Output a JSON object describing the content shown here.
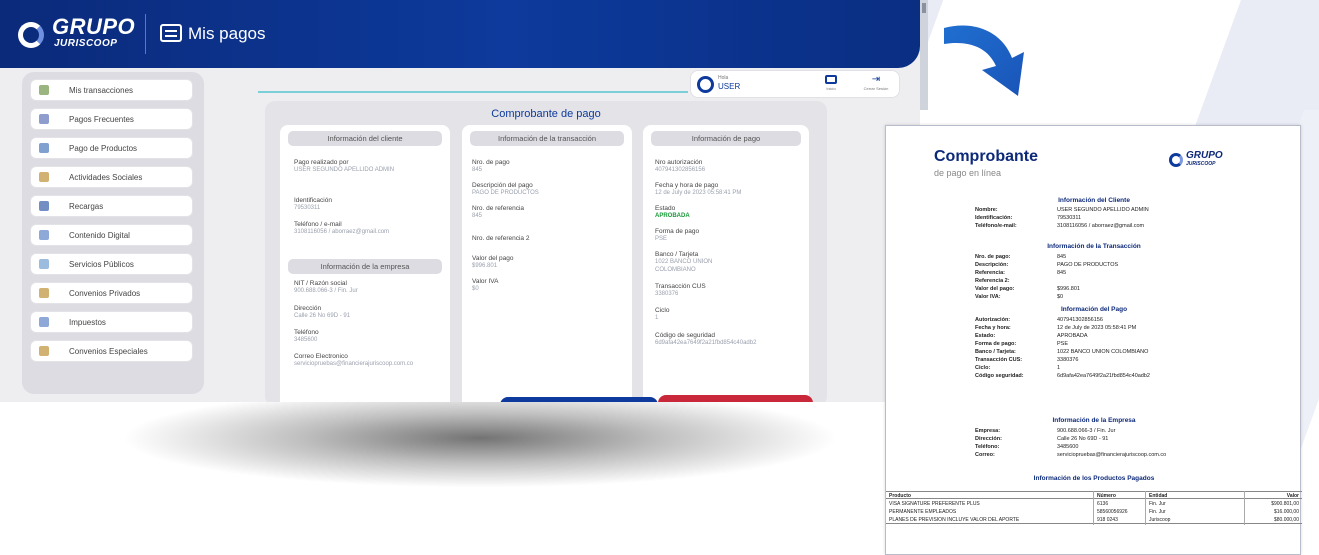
{
  "app": {
    "brand": "GRUPO",
    "brand_sub": "JURISCOOP",
    "title": "Mis pagos"
  },
  "sidebar": {
    "items": [
      {
        "label": "Mis transacciones",
        "color": "#8aa86a"
      },
      {
        "label": "Pagos Frecuentes",
        "color": "#7a8cc4"
      },
      {
        "label": "Pago de Productos",
        "color": "#6a8fc8"
      },
      {
        "label": "Actividades Sociales",
        "color": "#c9a45a"
      },
      {
        "label": "Recargas",
        "color": "#5a7ab8"
      },
      {
        "label": "Contenido Digital",
        "color": "#7a9ad0"
      },
      {
        "label": "Servicios Públicos",
        "color": "#8ab0d8"
      },
      {
        "label": "Convenios Privados",
        "color": "#c9a45a"
      },
      {
        "label": "Impuestos",
        "color": "#7a9ad0"
      },
      {
        "label": "Convenios Especiales",
        "color": "#c9a45a"
      }
    ]
  },
  "user": {
    "greeting": "Hola",
    "name": "USER",
    "btn_inicio": "Inicio",
    "btn_salir": "Cerrar Sesión"
  },
  "receipt": {
    "title": "Comprobante de pago",
    "client": {
      "header": "Información del cliente",
      "fields": [
        {
          "label": "Pago realizado por",
          "value": "USER SEGUNDO APELLIDO ADMIN"
        },
        {
          "label": "Identificación",
          "value": "79530311"
        },
        {
          "label": "Teléfono / e-mail",
          "value": "3108116056 / aborraez@gmail.com"
        }
      ]
    },
    "company": {
      "header": "Información de la empresa",
      "fields": [
        {
          "label": "NIT / Razón social",
          "value": "900.688.066-3 / Fin. Jur"
        },
        {
          "label": "Dirección",
          "value": "Calle 26 No 69D - 91"
        },
        {
          "label": "Teléfono",
          "value": "3485600"
        },
        {
          "label": "Correo Electronico",
          "value": "serviciopruebas@financierajuriscoop.com.co"
        }
      ]
    },
    "transaction": {
      "header": "Información de la transacción",
      "fields": [
        {
          "label": "Nro. de pago",
          "value": "845"
        },
        {
          "label": "Descripción del pago",
          "value": "PAGO DE PRODUCTOS"
        },
        {
          "label": "Nro. de referencia",
          "value": "845"
        },
        {
          "label": "Nro. de referencia 2",
          "value": ""
        },
        {
          "label": "Valor del pago",
          "value": "$996.801"
        },
        {
          "label": "Valor IVA",
          "value": "$0"
        }
      ]
    },
    "payment": {
      "header": "Información de pago",
      "fields": [
        {
          "label": "Nro autorización",
          "value": "407941302856156"
        },
        {
          "label": "Fecha y hora de pago",
          "value": "12 de July de 2023 05:58:41 PM"
        },
        {
          "label": "Estado",
          "value": "APROBADA"
        },
        {
          "label": "Forma de pago",
          "value": "PSE"
        },
        {
          "label": "Banco / Tarjeta",
          "value": "1022 BANCO UNION COLOMBIANO"
        },
        {
          "label": "Transacción CUS",
          "value": "3380376"
        },
        {
          "label": "Ciclo",
          "value": "1"
        },
        {
          "label": "Código de seguridad",
          "value": "6d9afa42ea7649f2a21fbd854c40adb2"
        }
      ]
    }
  },
  "pdf": {
    "title": "Comprobante",
    "subtitle": "de pago en línea",
    "logo": "GRUPO",
    "logo_sub": "JURISCOOP",
    "client_section": "Información del Cliente",
    "client": [
      {
        "k": "Nombre:",
        "v": "USER SEGUNDO APELLIDO ADMIN"
      },
      {
        "k": "Identificación:",
        "v": "79530311"
      },
      {
        "k": "Teléfono/e-mail:",
        "v": "3108116056 / aborraez@gmail.com"
      }
    ],
    "transaction_section": "Información de la Transacción",
    "transaction": [
      {
        "k": "Nro. de pago:",
        "v": "845"
      },
      {
        "k": "Descripción:",
        "v": "PAGO DE PRODUCTOS"
      },
      {
        "k": "Referencia:",
        "v": "845"
      },
      {
        "k": "Referencia 2:",
        "v": ""
      },
      {
        "k": "Valor del pago:",
        "v": "$996.801"
      },
      {
        "k": "Valor IVA:",
        "v": "$0"
      }
    ],
    "payment_section": "Información del Pago",
    "payment": [
      {
        "k": "Autorización:",
        "v": "407941302856156"
      },
      {
        "k": "Fecha y hora:",
        "v": "12 de July de 2023 05:58:41 PM"
      },
      {
        "k": "Estado:",
        "v": "APROBADA"
      },
      {
        "k": "Forma de pago:",
        "v": "PSE"
      },
      {
        "k": "Banco / Tarjeta:",
        "v": "1022 BANCO UNION COLOMBIANO"
      },
      {
        "k": "Transacción CUS:",
        "v": "3380376"
      },
      {
        "k": "Ciclo:",
        "v": "1"
      },
      {
        "k": "Código seguridad:",
        "v": "6d9afa42ea7649f2a21fbd854c40adb2"
      }
    ],
    "company_section": "Información de la Empresa",
    "company": [
      {
        "k": "Empresa:",
        "v": "900.688.066-3 / Fin. Jur"
      },
      {
        "k": "Dirección:",
        "v": "Calle 26 No 69D - 91"
      },
      {
        "k": "Teléfono:",
        "v": "3485600"
      },
      {
        "k": "Correo:",
        "v": "serviciopruebas@financierajuriscoop.com.co"
      }
    ],
    "products_section": "Información de los Productos Pagados",
    "products_headers": [
      "Producto",
      "Número",
      "Entidad",
      "Valor"
    ],
    "products": [
      [
        "VISA SIGNATURE PREFERENTE PLUS",
        "6136",
        "Fin. Jur",
        "$900.801,00"
      ],
      [
        "PERMANENTE EMPLEADOS",
        "58560056926",
        "Fin. Jur",
        "$16.000,00"
      ],
      [
        "PLANES DE PREVISION INCLUYE VALOR DEL APORTE",
        "918 0243",
        "Juriscoop",
        "$80.000,00"
      ]
    ]
  }
}
